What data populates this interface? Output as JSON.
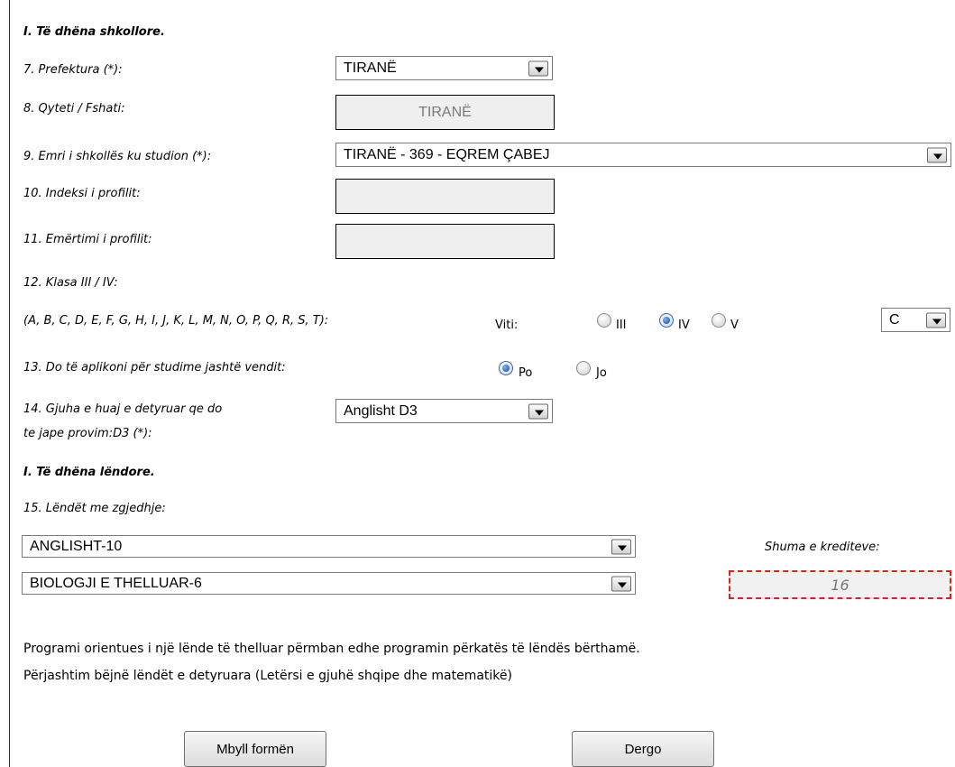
{
  "section_school": "I. Të dhëna shkollore.",
  "prefektura": {
    "label": "7. Prefektura (*):",
    "value": "TIRANË"
  },
  "qyteti": {
    "label": "8. Qyteti / Fshati:",
    "value": "TIRANË"
  },
  "shkolla": {
    "label": "9. Emri i shkollës ku studion (*):",
    "value": "TIRANË - 369 - EQREM ÇABEJ"
  },
  "indeksi": {
    "label": "10. Indeksi i profilit:",
    "value": ""
  },
  "emertimi": {
    "label": "11. Emërtimi i profilit:",
    "value": ""
  },
  "klasa": {
    "label": "12. Klasa III / IV:",
    "letters_label": "(A, B, C, D, E, F, G, H, I, J, K, L, M, N, O, P, Q, R, S, T):",
    "viti_label": "Viti:",
    "options": [
      "III",
      "IV",
      "V"
    ],
    "selected": "IV",
    "class_value": "C"
  },
  "studime": {
    "label": "13. Do të aplikoni për studime jashtë vendit:",
    "options": [
      "Po",
      "Jo"
    ],
    "selected": "Po"
  },
  "gjuha": {
    "label_line1": "14. Gjuha e huaj e detyruar qe do",
    "label_line2": "te jape provim:D3 (*):",
    "value": "Anglisht D3"
  },
  "section_subjects": "I. Të dhëna lëndore.",
  "lendet": {
    "label": "15. Lëndët me zgjedhje:",
    "subject1": "ANGLISHT-10",
    "subject2": "BIOLOGJI E THELLUAR-6",
    "credits_label": "Shuma e krediteve:",
    "credits_value": "16"
  },
  "note_line1": "Programi orientues i një lënde të thelluar përmban edhe programin përkatës të lëndës bërthamë.",
  "note_line2": "Përjashtim bëjnë lëndët e detyruara (Letërsi e gjuhë shqipe dhe matematikë)",
  "buttons": {
    "close": "Mbyll formën",
    "send": "Dergo"
  }
}
